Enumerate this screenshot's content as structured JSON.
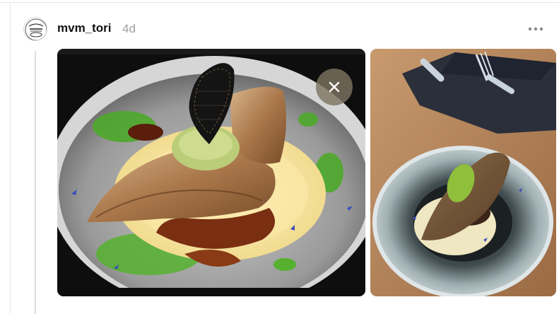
{
  "post": {
    "author": {
      "username": "mvm_tori",
      "avatar_icon": "restaurant-logo-icon"
    },
    "timestamp": "4d",
    "more_icon": "more-horizontal-icon"
  },
  "media": [
    {
      "kind": "photo",
      "subject": "plated-fish-dish-closeup"
    },
    {
      "kind": "photo",
      "subject": "plated-fish-dish-table"
    }
  ],
  "overlay": {
    "close_icon": "close-icon"
  },
  "colors": {
    "username": "#111111",
    "timestamp": "#a0a0a0",
    "close_button_bg": "#7d735f"
  }
}
